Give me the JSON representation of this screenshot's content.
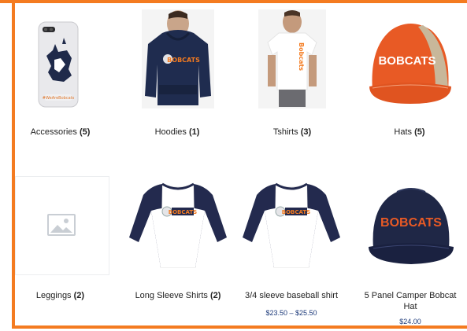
{
  "colors": {
    "frame_orange": "#f47b20",
    "navy": "#20294a",
    "hat_orange": "#e85a25",
    "price_blue": "#1d3a7a"
  },
  "categories": [
    {
      "name": "Accessories",
      "count": "(5)",
      "icon": "phone-case-bobcat-image"
    },
    {
      "name": "Hoodies",
      "count": "(1)",
      "icon": "navy-hoodie-image"
    },
    {
      "name": "Tshirts",
      "count": "(3)",
      "icon": "white-tshirt-image"
    },
    {
      "name": "Hats",
      "count": "(5)",
      "icon": "orange-trucker-hat-image"
    },
    {
      "name": "Leggings",
      "count": "(2)",
      "icon": "placeholder-image"
    },
    {
      "name": "Long Sleeve Shirts",
      "count": "(2)",
      "icon": "raglan-shirt-image"
    }
  ],
  "products": [
    {
      "name": "3/4 sleeve baseball shirt",
      "price": "$23.50 – $25.50",
      "icon": "raglan-shirt-image"
    },
    {
      "name_line1": "5 Panel Camper Bobcat",
      "name_line2": "Hat",
      "price": "$24.00",
      "icon": "navy-camper-hat-image"
    }
  ],
  "brand_text": {
    "hat": "BOBCATS",
    "shirt": "BOBCATS",
    "tshirt_vertical": "Bobcats",
    "phone_tag": "#WeAreBobcats"
  }
}
